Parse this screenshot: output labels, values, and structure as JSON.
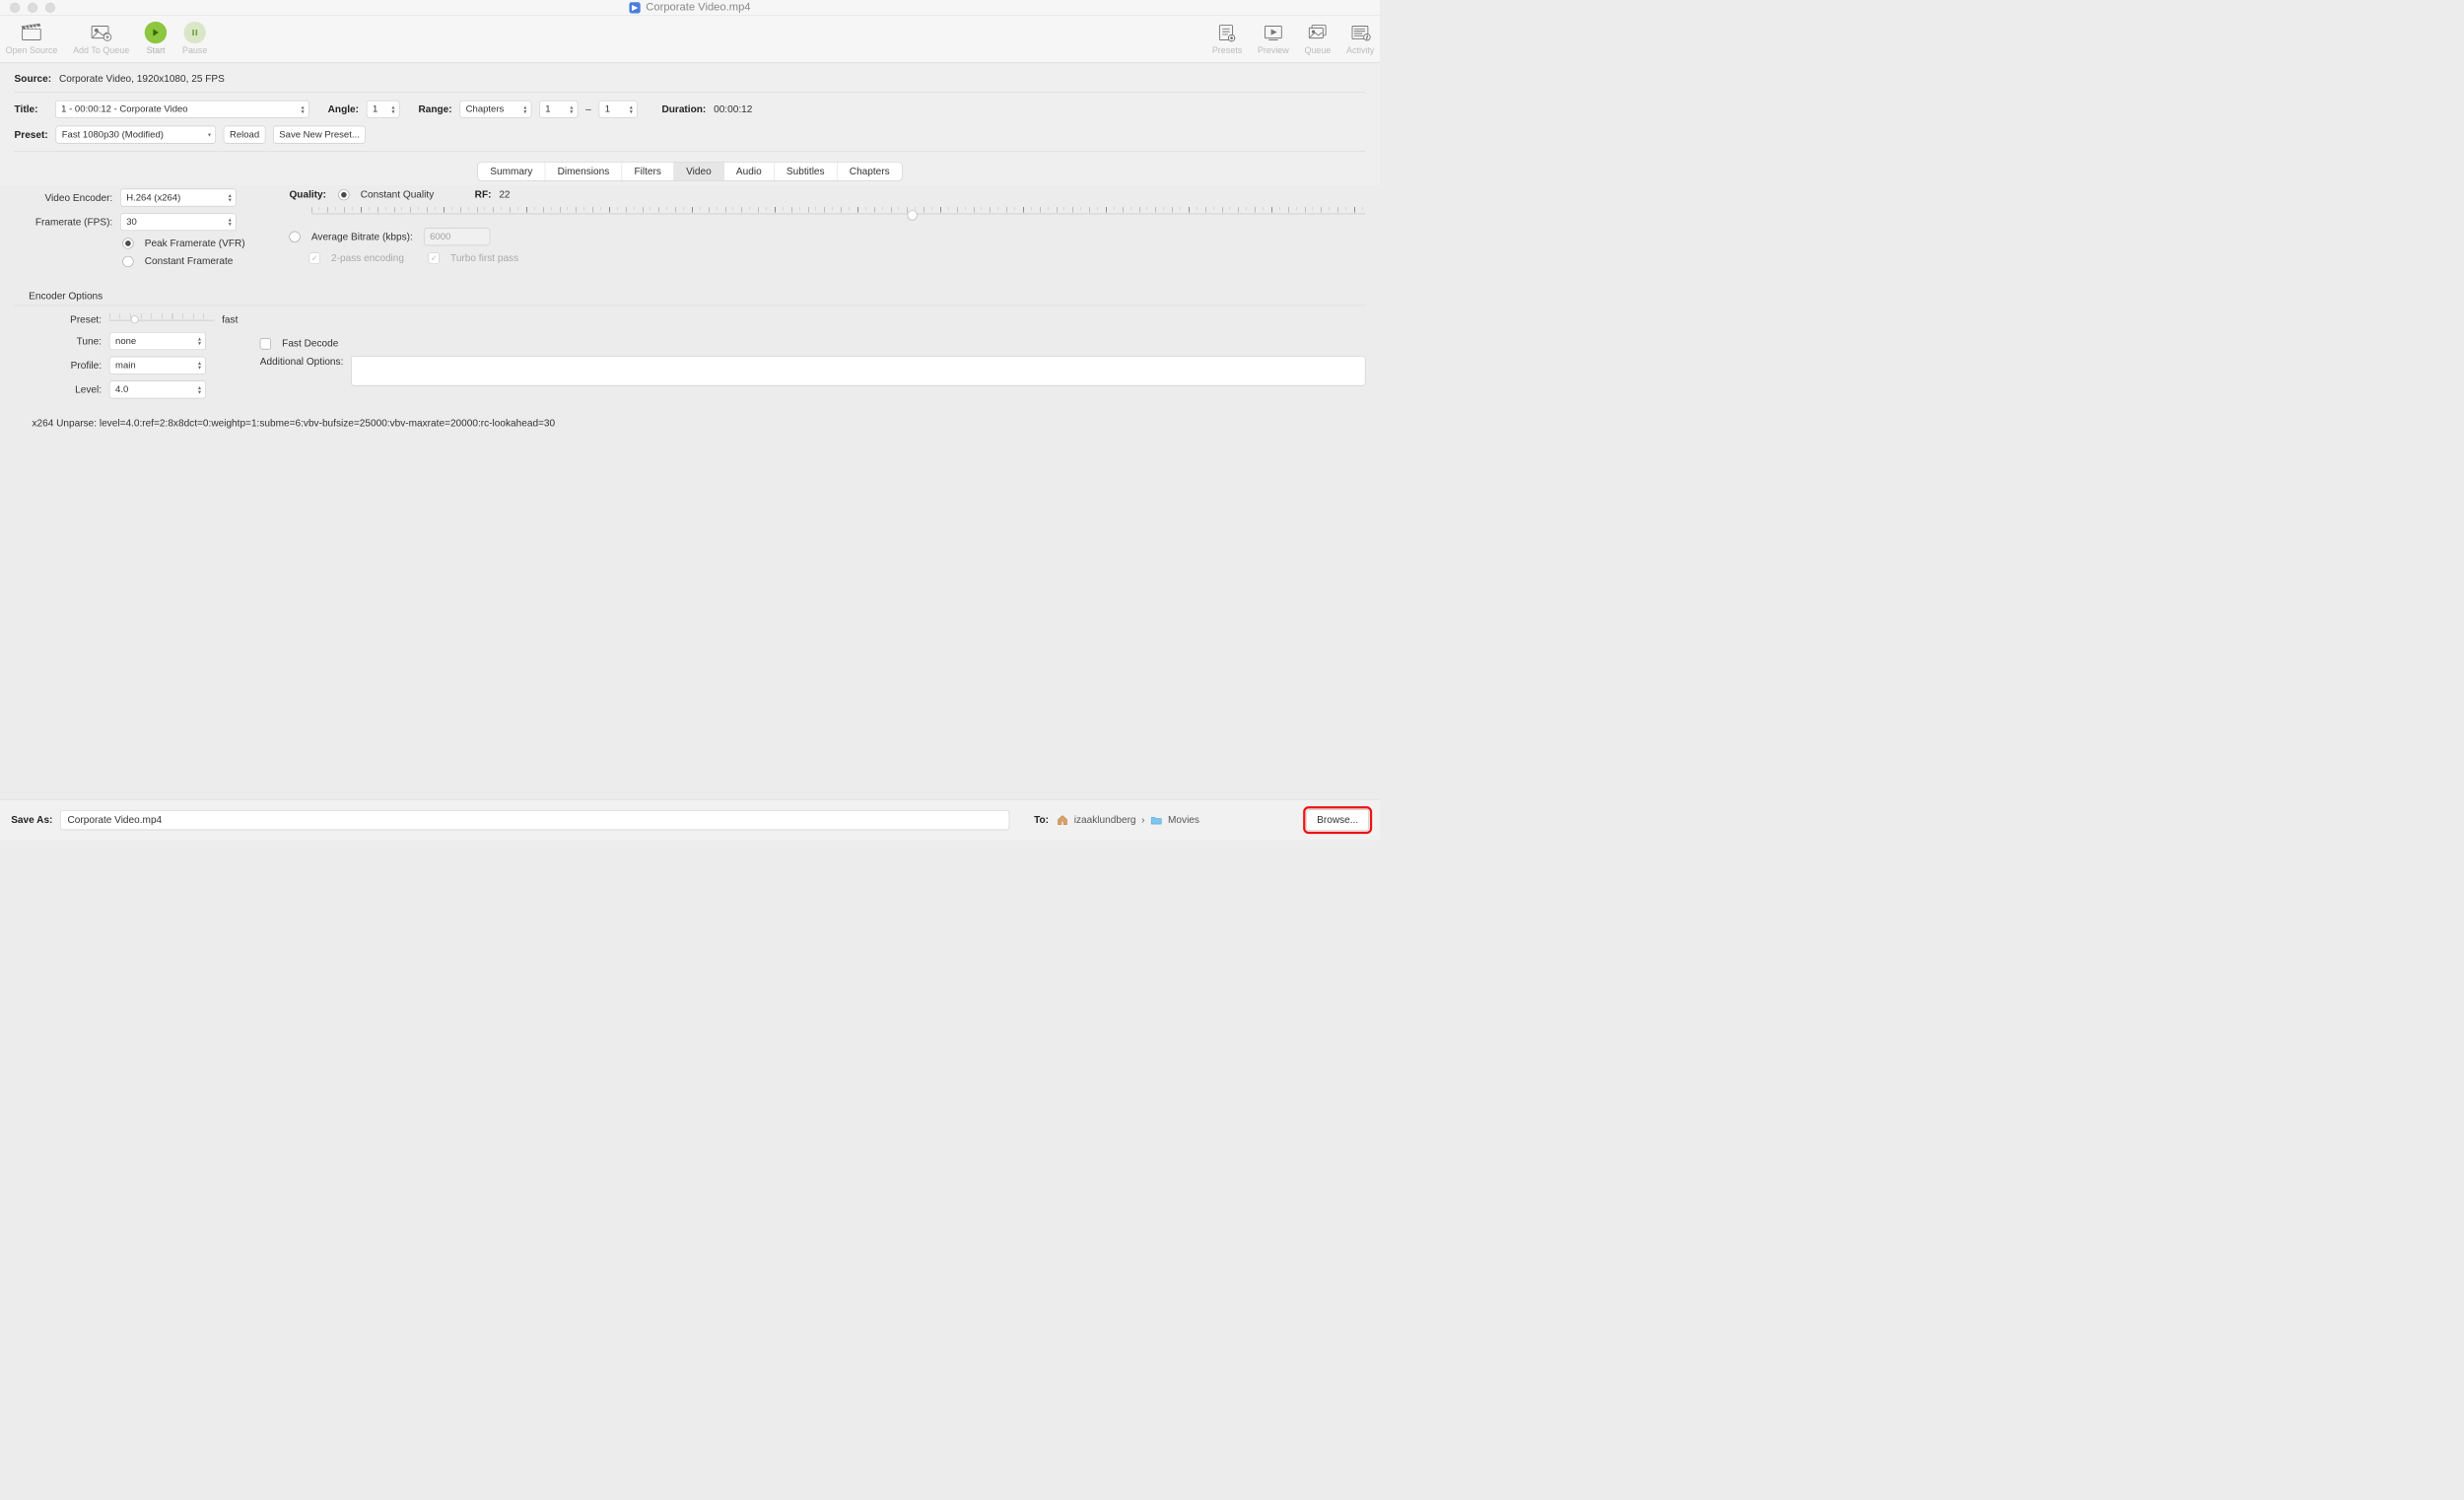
{
  "window": {
    "filename": "Corporate Video.mp4"
  },
  "toolbar": {
    "open_source": "Open Source",
    "add_to_queue": "Add To Queue",
    "start": "Start",
    "pause": "Pause",
    "presets": "Presets",
    "preview": "Preview",
    "queue": "Queue",
    "activity": "Activity"
  },
  "summary": {
    "source_label": "Source:",
    "source_text": "Corporate Video, 1920x1080, 25 FPS",
    "title_label": "Title:",
    "title_value": "1 - 00:00:12 - Corporate Video",
    "angle_label": "Angle:",
    "angle_value": "1",
    "range_label": "Range:",
    "range_mode": "Chapters",
    "range_from": "1",
    "range_dash": "–",
    "range_to": "1",
    "duration_label": "Duration:",
    "duration_value": "00:00:12",
    "preset_label": "Preset:",
    "preset_value": "Fast 1080p30 (Modified)",
    "reload": "Reload",
    "save_new_preset": "Save New Preset..."
  },
  "tabs": {
    "summary": "Summary",
    "dimensions": "Dimensions",
    "filters": "Filters",
    "video": "Video",
    "audio": "Audio",
    "subtitles": "Subtitles",
    "chapters": "Chapters",
    "active": "video"
  },
  "video": {
    "encoder_label": "Video Encoder:",
    "encoder": "H.264 (x264)",
    "fps_label": "Framerate (FPS):",
    "fps": "30",
    "peak_vfr": "Peak Framerate (VFR)",
    "constant_fr": "Constant Framerate",
    "quality_label": "Quality:",
    "constant_quality": "Constant Quality",
    "rf_label": "RF:",
    "rf_value": "22",
    "avg_bitrate": "Average Bitrate (kbps):",
    "bitrate_placeholder": "6000",
    "twopass": "2-pass encoding",
    "turbo": "Turbo first pass",
    "encoder_options_header": "Encoder Options",
    "preset_label": "Preset:",
    "preset_text": "fast",
    "tune_label": "Tune:",
    "tune_value": "none",
    "fast_decode": "Fast Decode",
    "profile_label": "Profile:",
    "profile_value": "main",
    "additional_label": "Additional Options:",
    "level_label": "Level:",
    "level_value": "4.0",
    "unparse": "x264 Unparse: level=4.0:ref=2:8x8dct=0:weightp=1:subme=6:vbv-bufsize=25000:vbv-maxrate=20000:rc-lookahead=30"
  },
  "footer": {
    "save_as_label": "Save As:",
    "save_as_value": "Corporate Video.mp4",
    "to_label": "To:",
    "path_user": "izaaklundberg",
    "path_sep": "›",
    "path_folder": "Movies",
    "browse": "Browse..."
  }
}
